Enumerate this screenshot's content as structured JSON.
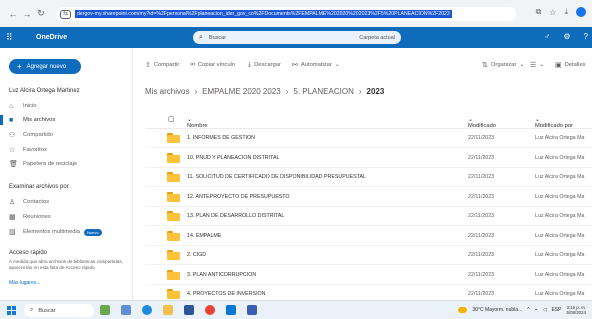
{
  "browser": {
    "url": "dergov-my.sharepoint.com/my?id=%2Fpersonal%2Fplaneacion_ider_gov_co%2FDocuments%2FEMPALME%202020%202023%2F5%20PLANEACION%2F2023"
  },
  "header": {
    "app_name": "OneDrive",
    "search_placeholder": "Buscar",
    "search_scope": "Carpeta actual"
  },
  "sidebar": {
    "new_button": "Agregar nuevo",
    "user_name": "Luz Alcira Ortega Martinez",
    "items": [
      {
        "label": "Inicio",
        "icon": "home-icon"
      },
      {
        "label": "Mis archivos",
        "icon": "folder-icon",
        "active": true
      },
      {
        "label": "Compartido",
        "icon": "people-icon"
      },
      {
        "label": "Favoritos",
        "icon": "star-icon"
      },
      {
        "label": "Papelera de reciclaje",
        "icon": "trash-icon"
      }
    ],
    "browse_heading": "Examinar archivos por",
    "browse_items": [
      {
        "label": "Contactos",
        "icon": "person-icon"
      },
      {
        "label": "Reuniones",
        "icon": "calendar-icon"
      },
      {
        "label": "Elementos multimedia",
        "icon": "image-icon",
        "badge": "Nuevo"
      }
    ],
    "quick_access_heading": "Acceso rápido",
    "quick_access_text": "A medida que abra archivos de bibliotecas compartidas, aparecerán en esta lista de Acceso rápido.",
    "more_places": "Más lugares..."
  },
  "commands": {
    "share": "Compartir",
    "copy_link": "Copiar vínculo",
    "download": "Descargar",
    "automate": "Automatizar",
    "sort": "Organizar",
    "view": "",
    "details": "Detalles"
  },
  "breadcrumb": {
    "root": "Mis archivos",
    "level1": "EMPALME 2020 2023",
    "level2": "5. PLANEACION",
    "current": "2023"
  },
  "columns": {
    "name": "Nombre",
    "modified": "Modificado",
    "modified_by": "Modificado por"
  },
  "files": [
    {
      "name": "1. INFORMES DE GESTION",
      "modified": "22/11/2023",
      "by": "Luz Alcira Ortega Ma"
    },
    {
      "name": "10. PNUD Y PLANEACION DISTRITAL",
      "modified": "22/11/2023",
      "by": "Luz Alcira Ortega Ma"
    },
    {
      "name": "11. SOLICITUD DE CERTIFICADO DE DISPONIBILIDAD PRESUPUESTAL",
      "modified": "22/11/2023",
      "by": "Luz Alcira Ortega Ma"
    },
    {
      "name": "12. ANTEPROYECTO DE PRESUPUESTO",
      "modified": "22/11/2023",
      "by": "Luz Alcira Ortega Ma"
    },
    {
      "name": "13. PLAN DE DESARROLLO DISTRITAL",
      "modified": "22/11/2023",
      "by": "Luz Alcira Ortega Ma"
    },
    {
      "name": "14. EMPALME",
      "modified": "22/11/2023",
      "by": "Luz Alcira Ortega Ma"
    },
    {
      "name": "2. CIGD",
      "modified": "22/11/2023",
      "by": "Luz Alcira Ortega Ma"
    },
    {
      "name": "3. PLAN ANTICORRUPCION",
      "modified": "22/11/2023",
      "by": "Luz Alcira Ortega Ma"
    },
    {
      "name": "4. PROYECTOS DE INVERSION",
      "modified": "22/11/2023",
      "by": "Luz Alcira Ortega Ma"
    }
  ],
  "taskbar": {
    "search": "Buscar",
    "weather": "30°C Mayorm. nubla...",
    "language": "ESP",
    "time": "3:16 p. m.",
    "date": "5/08/2024"
  },
  "colors": {
    "accent": "#0f6cbd",
    "folder": "#fcc23b",
    "url_highlight": "#1a56d6"
  }
}
